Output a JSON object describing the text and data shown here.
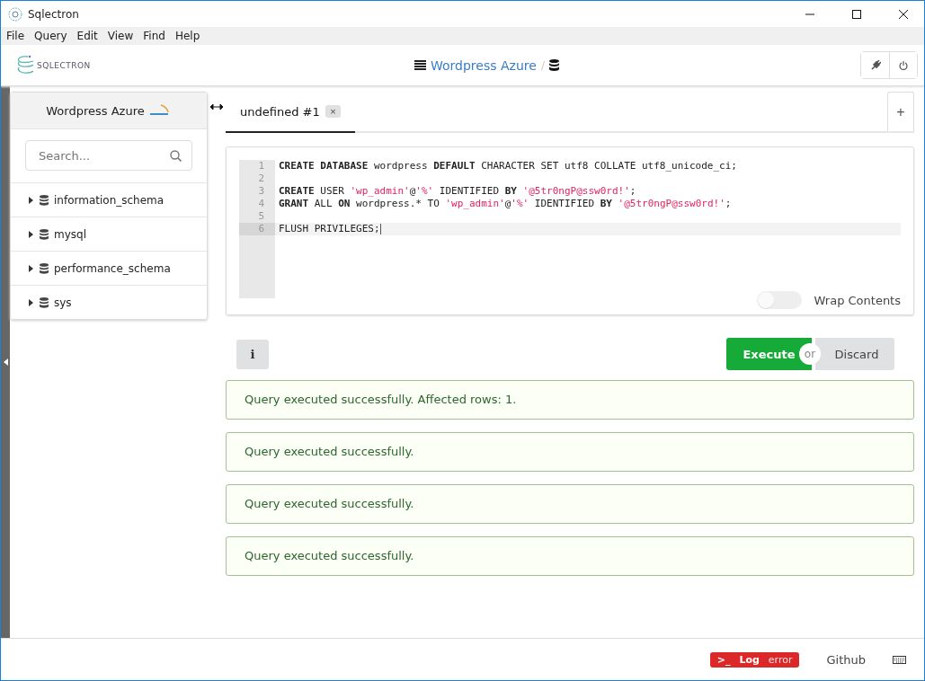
{
  "window": {
    "title": "Sqlectron"
  },
  "menu": [
    "File",
    "Query",
    "Edit",
    "View",
    "Find",
    "Help"
  ],
  "header": {
    "logo_text": "SQLECTRON",
    "server": "Wordpress Azure",
    "separator": "/"
  },
  "sidebar": {
    "title": "Wordpress Azure",
    "search": {
      "placeholder": "Search..."
    },
    "databases": [
      {
        "name": "information_schema",
        "expanded": false
      },
      {
        "name": "mysql",
        "expanded": false
      },
      {
        "name": "performance_schema",
        "expanded": false
      },
      {
        "name": "sys",
        "expanded": false
      }
    ]
  },
  "tabs": [
    {
      "label": "undefined #1",
      "close": "×",
      "selected": true
    }
  ],
  "add_tab": "+",
  "editor": {
    "lines": [
      {
        "number": "1",
        "active": false,
        "tokens": [
          {
            "kind": "kw",
            "text": "CREATE DATABASE"
          },
          {
            "kind": "plain",
            "text": " wordpress "
          },
          {
            "kind": "kw",
            "text": "DEFAULT"
          },
          {
            "kind": "plain",
            "text": " CHARACTER SET utf8 COLLATE utf8_unicode_ci;"
          }
        ]
      },
      {
        "number": "2",
        "active": false
      },
      {
        "number": "3",
        "active": false,
        "tokens": [
          {
            "kind": "kw",
            "text": "CREATE"
          },
          {
            "kind": "plain",
            "text": " USER "
          },
          {
            "kind": "str",
            "text": "'wp_admin'"
          },
          {
            "kind": "plain",
            "text": "@"
          },
          {
            "kind": "str",
            "text": "'%'"
          },
          {
            "kind": "plain",
            "text": " IDENTIFIED "
          },
          {
            "kind": "kw",
            "text": "BY"
          },
          {
            "kind": "str",
            "text": " '@5tr0ngP@ssw0rd!'"
          },
          {
            "kind": "plain",
            "text": ";"
          }
        ]
      },
      {
        "number": "4",
        "active": false,
        "tokens": [
          {
            "kind": "kw",
            "text": "GRANT"
          },
          {
            "kind": "plain",
            "text": " ALL "
          },
          {
            "kind": "kw",
            "text": "ON"
          },
          {
            "kind": "plain",
            "text": " wordpress.* TO "
          },
          {
            "kind": "str",
            "text": "'wp_admin'"
          },
          {
            "kind": "plain",
            "text": "@"
          },
          {
            "kind": "str",
            "text": "'%'"
          },
          {
            "kind": "plain",
            "text": " IDENTIFIED "
          },
          {
            "kind": "kw",
            "text": "BY"
          },
          {
            "kind": "str",
            "text": " '@5tr0ngP@ssw0rd!'"
          },
          {
            "kind": "plain",
            "text": ";"
          }
        ]
      },
      {
        "number": "5",
        "active": false
      },
      {
        "number": "6",
        "active": true,
        "tokens": [
          {
            "kind": "plain",
            "text": "FLUSH PRIVILEGES;"
          }
        ]
      }
    ],
    "wrap": {
      "label": "Wrap Contents",
      "on": false
    }
  },
  "actions": {
    "info": "i",
    "execute": "Execute",
    "or": "or",
    "discard": "Discard"
  },
  "results": [
    "Query executed successfully. Affected rows: 1.",
    "Query executed successfully.",
    "Query executed successfully.",
    "Query executed successfully."
  ],
  "footer": {
    "log_prompt": ">_",
    "log": "Log",
    "log_status": "error",
    "github": "Github"
  }
}
